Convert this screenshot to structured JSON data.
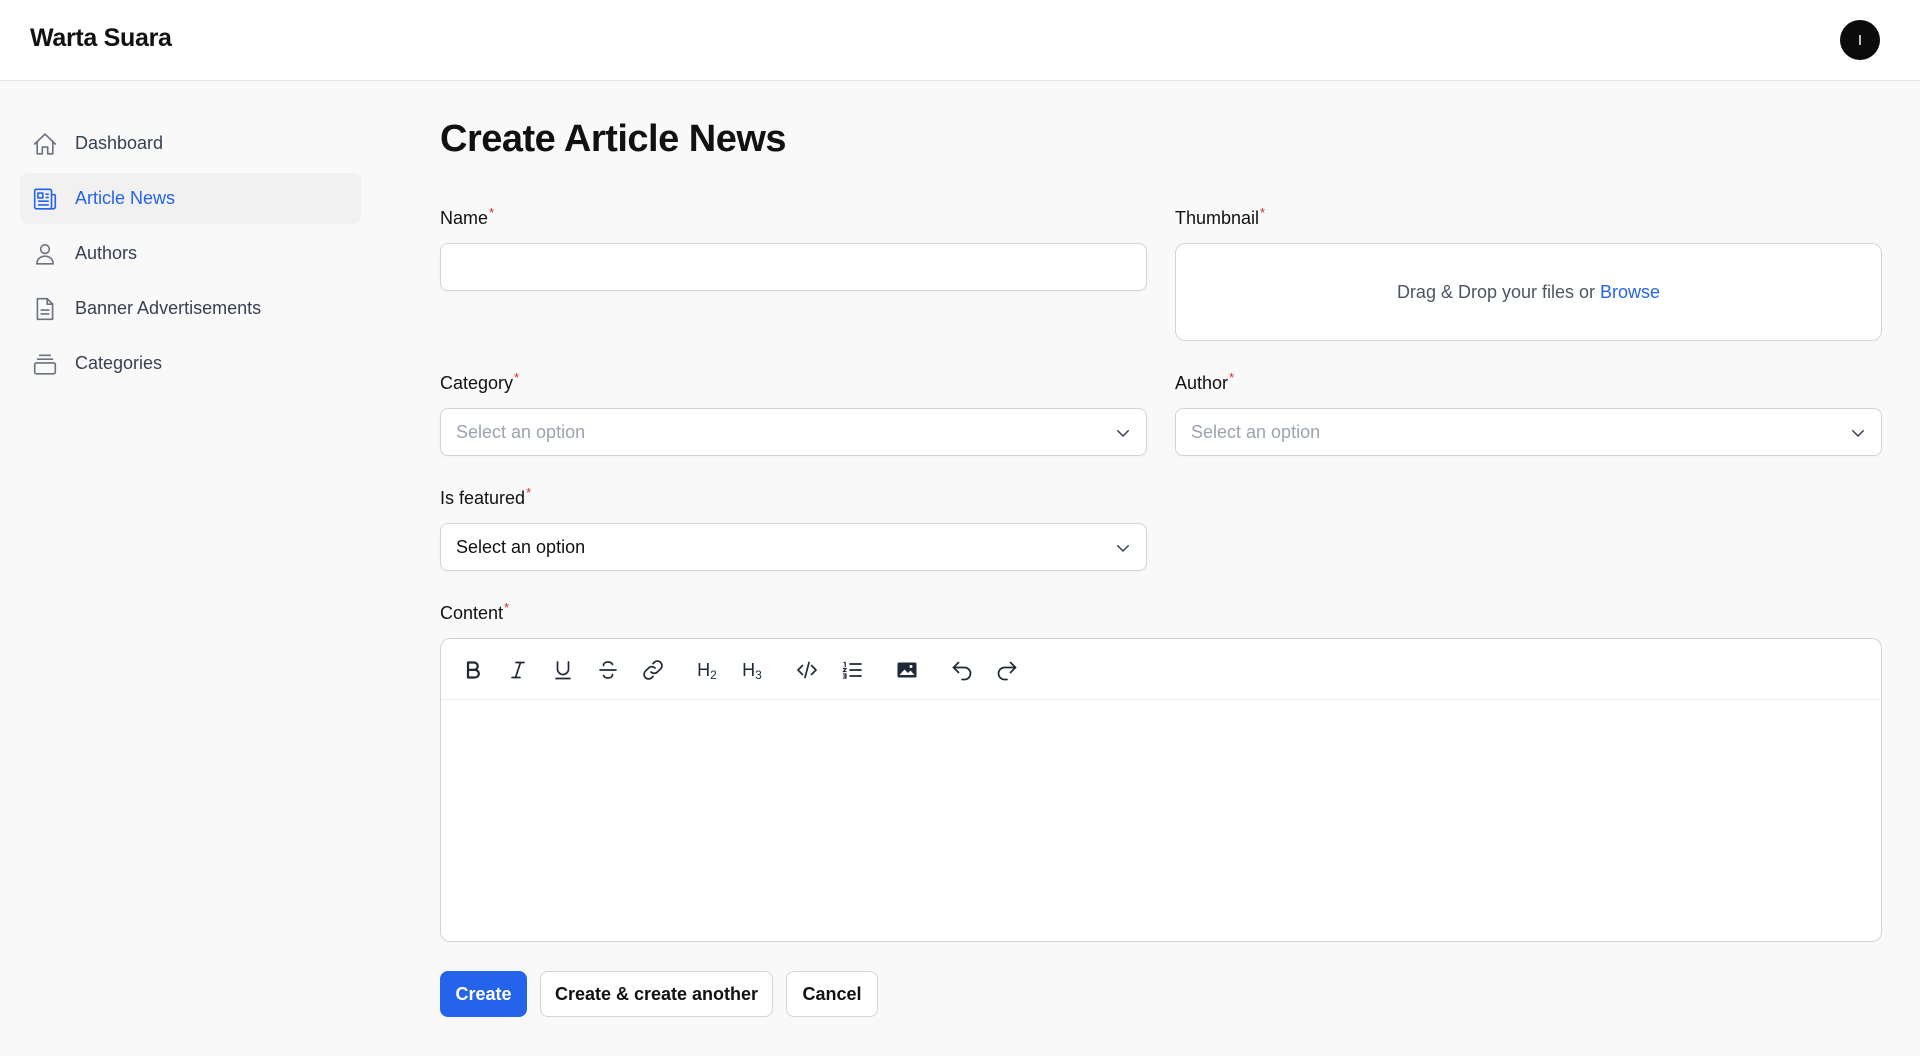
{
  "app": {
    "brand": "Warta Suara",
    "user_initial": "I"
  },
  "sidebar": {
    "items": [
      {
        "label": "Dashboard",
        "icon": "home-icon",
        "active": false
      },
      {
        "label": "Article News",
        "icon": "newspaper-icon",
        "active": true
      },
      {
        "label": "Authors",
        "icon": "user-icon",
        "active": false
      },
      {
        "label": "Banner Advertisements",
        "icon": "document-icon",
        "active": false
      },
      {
        "label": "Categories",
        "icon": "archive-box-icon",
        "active": false
      }
    ]
  },
  "page": {
    "title": "Create Article News"
  },
  "form": {
    "required_marker": "*",
    "name": {
      "label": "Name",
      "value": ""
    },
    "thumbnail": {
      "label": "Thumbnail",
      "drop_text": "Drag & Drop your files or",
      "browse_label": "Browse"
    },
    "category": {
      "label": "Category",
      "selected": "Select an option"
    },
    "author": {
      "label": "Author",
      "selected": "Select an option"
    },
    "is_featured": {
      "label": "Is featured",
      "selected": "Select an option"
    },
    "content": {
      "label": "Content",
      "toolbar": [
        "bold-icon",
        "italic-icon",
        "underline-icon",
        "strikethrough-icon",
        "link-icon",
        "heading-2-icon",
        "heading-3-icon",
        "code-block-icon",
        "ordered-list-icon",
        "image-icon",
        "undo-icon",
        "redo-icon"
      ],
      "h2_main": "H",
      "h2_sub": "2",
      "h3_main": "H",
      "h3_sub": "3",
      "value": ""
    }
  },
  "actions": {
    "create": "Create",
    "create_another": "Create & create another",
    "cancel": "Cancel"
  },
  "colors": {
    "primary": "#2563eb",
    "required": "#dc2626",
    "avatar": "#0b0b0b"
  }
}
